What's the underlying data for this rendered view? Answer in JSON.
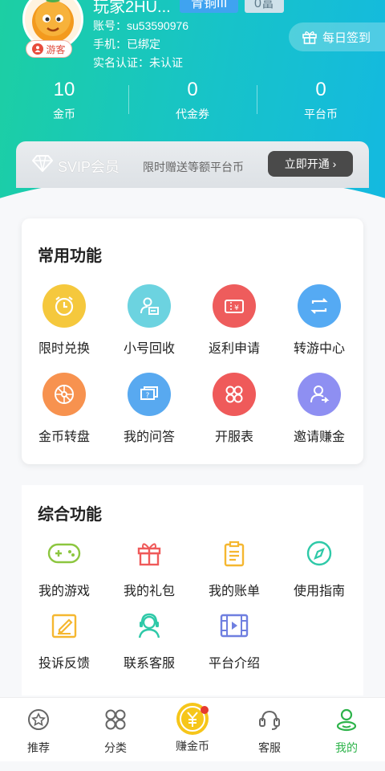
{
  "profile": {
    "username": "玩家2HU...",
    "level": "青铜III",
    "wealth": "0富",
    "guest_label": "游客",
    "account_line": "账号：su53590976",
    "phone_line": "手机：已绑定",
    "realname_line": "实名认证：未认证"
  },
  "checkin": {
    "label": "每日签到"
  },
  "stats": [
    {
      "value": "10",
      "label": "金币"
    },
    {
      "value": "0",
      "label": "代金券"
    },
    {
      "value": "0",
      "label": "平台币"
    }
  ],
  "svip": {
    "title": "SVIP会员",
    "desc": "限时赠送等额平台币",
    "button": "立即开通 ›"
  },
  "common": {
    "title": "常用功能",
    "items": [
      {
        "label": "限时兑换",
        "icon": "alarm-clock-icon",
        "color": "#f5c83d"
      },
      {
        "label": "小号回收",
        "icon": "account-recycle-icon",
        "color": "#6cd3e0"
      },
      {
        "label": "返利申请",
        "icon": "rebate-ticket-icon",
        "color": "#ee5c5c"
      },
      {
        "label": "转游中心",
        "icon": "transfer-icon",
        "color": "#55aaf3"
      },
      {
        "label": "金币转盘",
        "icon": "wheel-icon",
        "color": "#f7924f"
      },
      {
        "label": "我的问答",
        "icon": "qa-icon",
        "color": "#58a9f0"
      },
      {
        "label": "开服表",
        "icon": "server-grid-icon",
        "color": "#ef5a5a"
      },
      {
        "label": "邀请赚金",
        "icon": "invite-icon",
        "color": "#8e8ff2"
      }
    ]
  },
  "general": {
    "title": "综合功能",
    "items": [
      {
        "label": "我的游戏",
        "icon": "gamepad-icon",
        "color": "#8cc63f"
      },
      {
        "label": "我的礼包",
        "icon": "gift-icon",
        "color": "#ef5a5a"
      },
      {
        "label": "我的账单",
        "icon": "bill-icon",
        "color": "#f5b730"
      },
      {
        "label": "使用指南",
        "icon": "compass-icon",
        "color": "#2ec9a8"
      },
      {
        "label": "投诉反馈",
        "icon": "feedback-edit-icon",
        "color": "#f5b730"
      },
      {
        "label": "联系客服",
        "icon": "customer-service-icon",
        "color": "#2ec9a8"
      },
      {
        "label": "平台介绍",
        "icon": "video-intro-icon",
        "color": "#6f7fe0"
      }
    ]
  },
  "tabs": [
    {
      "label": "推荐",
      "icon": "star-icon"
    },
    {
      "label": "分类",
      "icon": "category-icon"
    },
    {
      "label": "赚金币",
      "icon": "yen-coin-icon"
    },
    {
      "label": "客服",
      "icon": "headset-icon"
    },
    {
      "label": "我的",
      "icon": "user-icon",
      "active": true
    }
  ]
}
